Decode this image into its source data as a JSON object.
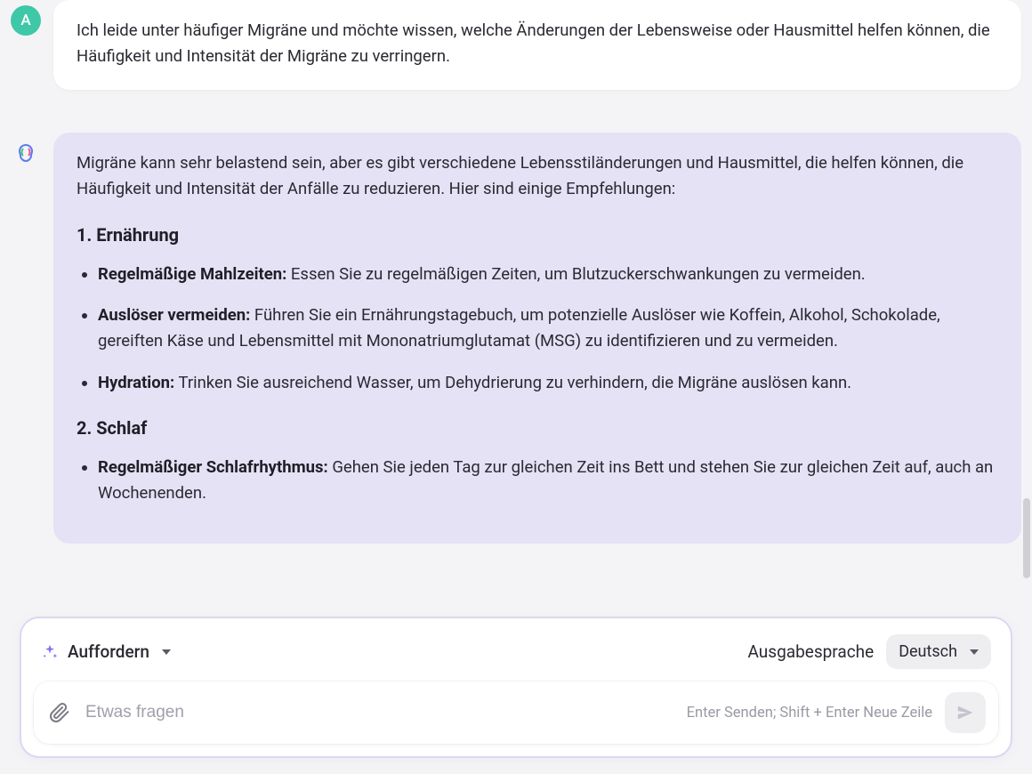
{
  "user": {
    "avatar_letter": "A",
    "message": "Ich leide unter häufiger Migräne und möchte wissen, welche Änderungen der Lebensweise oder Hausmittel helfen können, die Häufigkeit und Intensität der Migräne zu verringern."
  },
  "assistant": {
    "intro": "Migräne kann sehr belastend sein, aber es gibt verschiedene Lebensstiländerungen und Hausmittel, die helfen können, die Häufigkeit und Intensität der Anfälle zu reduzieren. Hier sind einige Empfehlungen:",
    "sections": {
      "0": {
        "heading": "1. Ernährung",
        "items": {
          "0": {
            "label": "Regelmäßige Mahlzeiten:",
            "text": " Essen Sie zu regelmäßigen Zeiten, um Blutzuckerschwankungen zu vermeiden."
          },
          "1": {
            "label": "Auslöser vermeiden:",
            "text": " Führen Sie ein Ernährungstagebuch, um potenzielle Auslöser wie Koffein, Alkohol, Schokolade, gereiften Käse und Lebensmittel mit Mononatriumglutamat (MSG) zu identifizieren und zu vermeiden."
          },
          "2": {
            "label": "Hydration:",
            "text": " Trinken Sie ausreichend Wasser, um Dehydrierung zu verhindern, die Migräne auslösen kann."
          }
        }
      },
      "1": {
        "heading": "2. Schlaf",
        "items": {
          "0": {
            "label": "Regelmäßiger Schlafrhythmus:",
            "text": " Gehen Sie jeden Tag zur gleichen Zeit ins Bett und stehen Sie zur gleichen Zeit auf, auch an Wochenenden."
          }
        }
      }
    }
  },
  "composer": {
    "mode_label": "Auffordern",
    "lang_label": "Ausgabesprache",
    "lang_value": "Deutsch",
    "placeholder": "Etwas fragen",
    "hint": "Enter Senden; Shift + Enter Neue Zeile"
  }
}
